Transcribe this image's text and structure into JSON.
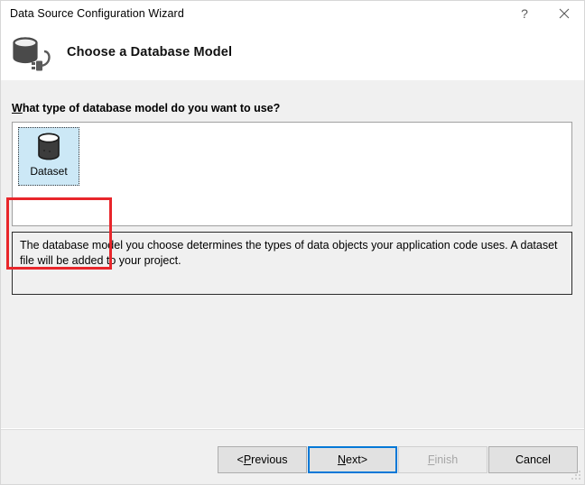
{
  "window": {
    "title": "Data Source Configuration Wizard",
    "help_icon": "help-question-icon",
    "help_label": "?",
    "close_icon": "close-x-icon"
  },
  "header": {
    "icon": "database-connection-icon",
    "title": "Choose a Database Model"
  },
  "main": {
    "question": "What type of database model do you want to use?",
    "question_accesskey": "W",
    "question_rest": "hat type of database model do you want to use?",
    "models": [
      {
        "label": "Dataset",
        "icon": "database-cylinder-icon",
        "selected": true
      }
    ],
    "description": "The database model you choose determines the types of data objects your application code uses. A dataset file will be added to your project."
  },
  "annotation": {
    "name": "red-highlight-box",
    "color": "#e8262b",
    "target": "Dataset"
  },
  "footer": {
    "buttons": [
      {
        "name": "previous-button",
        "prefix": "< ",
        "accesskey": "P",
        "rest": "revious",
        "suffix": "",
        "enabled": true,
        "focused": false
      },
      {
        "name": "next-button",
        "prefix": "",
        "accesskey": "N",
        "rest": "ext",
        "suffix": " >",
        "enabled": true,
        "focused": true
      },
      {
        "name": "finish-button",
        "prefix": "",
        "accesskey": "F",
        "rest": "inish",
        "suffix": "",
        "enabled": false,
        "focused": false
      },
      {
        "name": "cancel-button",
        "prefix": "",
        "accesskey": "",
        "rest": "Cancel",
        "suffix": "",
        "enabled": true,
        "focused": false
      }
    ],
    "resize_grip": "resize-grip-icon"
  },
  "colors": {
    "accent": "#0078d7",
    "selection": "#cce8f6",
    "annotation": "#e8262b",
    "window_bg": "#f0f0f0",
    "panel_bg": "#ffffff"
  }
}
